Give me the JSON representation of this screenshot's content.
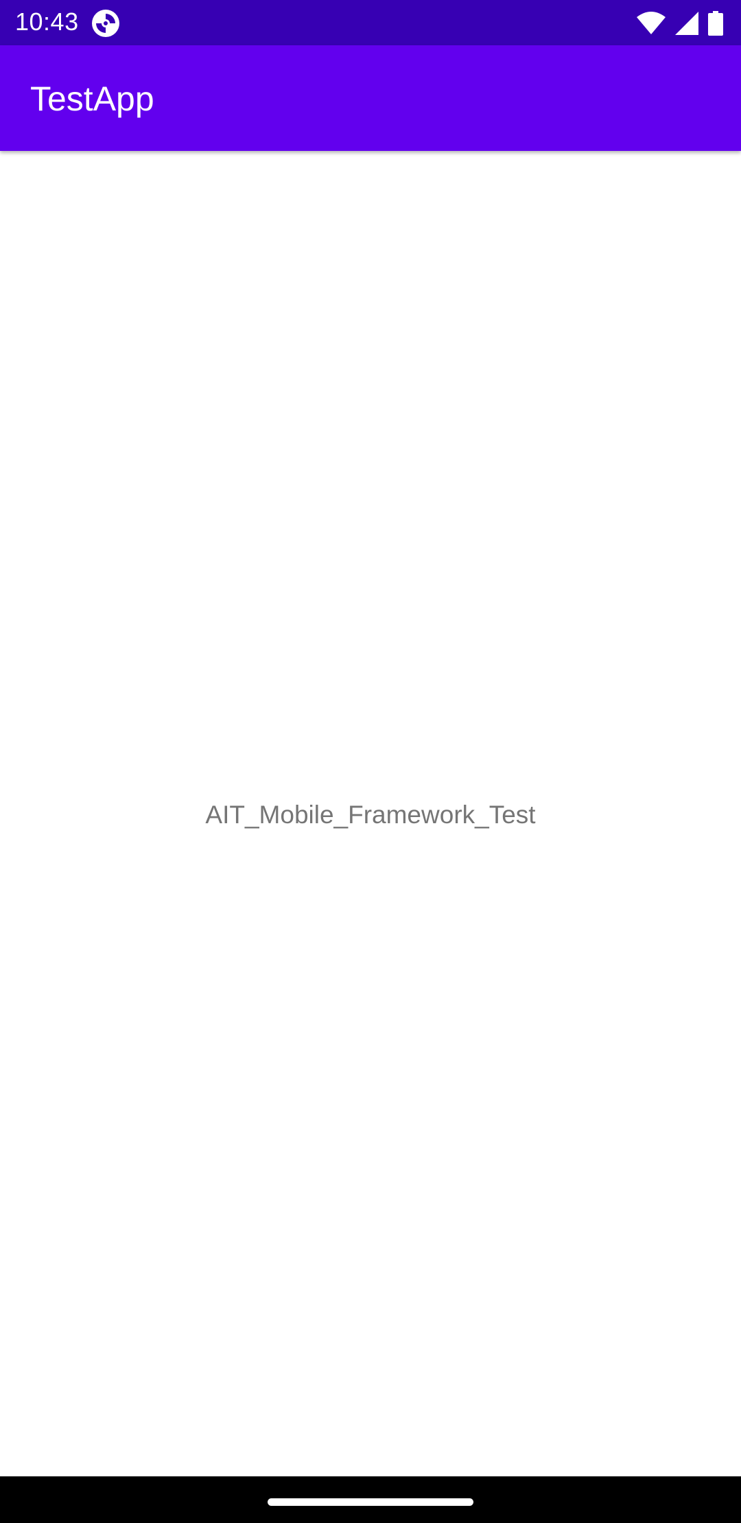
{
  "status_bar": {
    "time": "10:43",
    "icons": [
      "app-notification-icon",
      "wifi-icon",
      "cellular-signal-icon",
      "battery-icon"
    ]
  },
  "app_bar": {
    "title": "TestApp"
  },
  "main": {
    "label": "AIT_Mobile_Framework_Test"
  },
  "colors": {
    "status_bar": "#3700b3",
    "app_bar": "#6200ee",
    "background": "#ffffff",
    "label_text": "#757575",
    "nav_bar": "#000000"
  }
}
